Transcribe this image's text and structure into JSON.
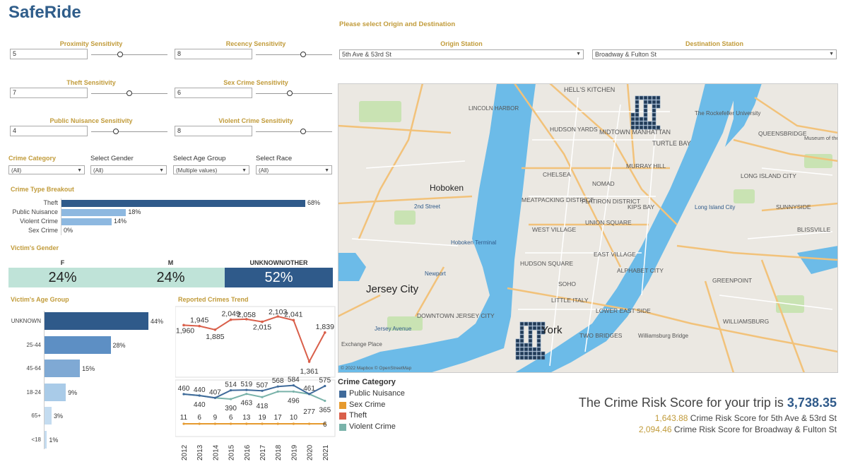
{
  "app_title": "SafeRide",
  "prompt_text": "Please select Origin and Destination",
  "sliders": [
    {
      "label": "Proximity Sensitivity",
      "value": "5",
      "knob": 0.38
    },
    {
      "label": "Recency Sensitivity",
      "value": "8",
      "knob": 0.62
    },
    {
      "label": "Theft Sensitivity",
      "value": "7",
      "knob": 0.5
    },
    {
      "label": "Sex Crime Sensitivity",
      "value": "6",
      "knob": 0.44
    },
    {
      "label": "Public Nuisance Sensitivity",
      "value": "4",
      "knob": 0.32
    },
    {
      "label": "Violent Crime Sensitivity",
      "value": "8",
      "knob": 0.62
    }
  ],
  "origin": {
    "label": "Origin Station",
    "value": "5th Ave & 53rd St"
  },
  "destination": {
    "label": "Destination Station",
    "value": "Broadway & Fulton St"
  },
  "filters": [
    {
      "label": "Crime Category",
      "value": "(All)"
    },
    {
      "label": "Select Gender",
      "value": "(All)"
    },
    {
      "label": "Select Age Group",
      "value": "(Multiple values)"
    },
    {
      "label": "Select Race",
      "value": "(All)"
    }
  ],
  "crime_type": {
    "title": "Crime Type Breakout",
    "items": [
      {
        "label": "Theft",
        "value": 68,
        "text": "68%",
        "color": "#2f5a8a"
      },
      {
        "label": "Public Nuisance",
        "value": 18,
        "text": "18%",
        "color": "#8db8e0"
      },
      {
        "label": "Violent Crime",
        "value": 14,
        "text": "14%",
        "color": "#8db8e0"
      },
      {
        "label": "Sex Crime",
        "value": 0,
        "text": "0%",
        "color": "#8db8e0"
      }
    ]
  },
  "gender": {
    "title": "Victim's Gender",
    "items": [
      {
        "label": "F",
        "value": "24%",
        "bg": "#bfe3d8",
        "fg": "#222"
      },
      {
        "label": "M",
        "value": "24%",
        "bg": "#bfe3d8",
        "fg": "#222"
      },
      {
        "label": "UNKNOWN/OTHER",
        "value": "52%",
        "bg": "#2f5a8a",
        "fg": "#fff"
      }
    ]
  },
  "age": {
    "title": "Victim's Age Group",
    "items": [
      {
        "label": "UNKNOWN",
        "value": 44,
        "text": "44%",
        "color": "#2f5a8a"
      },
      {
        "label": "25-44",
        "value": 28,
        "text": "28%",
        "color": "#5d8fc4"
      },
      {
        "label": "45-64",
        "value": 15,
        "text": "15%",
        "color": "#7fa9d4"
      },
      {
        "label": "18-24",
        "value": 9,
        "text": "9%",
        "color": "#a9cbe8"
      },
      {
        "label": "65+",
        "value": 3,
        "text": "3%",
        "color": "#c4dcf0"
      },
      {
        "label": "<18",
        "value": 1,
        "text": "1%",
        "color": "#c4dcf0"
      }
    ]
  },
  "chart_data": {
    "type": "line",
    "title": "Reported Crimes Trend",
    "x": [
      "2012",
      "2013",
      "2014",
      "2015",
      "2016",
      "2017",
      "2018",
      "2019",
      "2020",
      "2021"
    ],
    "totals": [
      1960,
      1945,
      1885,
      2049,
      2058,
      2015,
      2103,
      2041,
      1361,
      1839
    ],
    "totals_labels": [
      "1,960",
      "1,945",
      "1,885",
      "2,049",
      "2,058",
      "2,015",
      "2,103",
      "2,041",
      "1,361",
      "1,839"
    ],
    "series": [
      {
        "name": "Public Nuisance",
        "color": "#3f6a9a",
        "values": [
          460,
          440,
          407,
          514,
          519,
          507,
          568,
          584,
          461,
          575
        ]
      },
      {
        "name": "Sex Crime",
        "color": "#e69a2e",
        "values": [
          11,
          6,
          9,
          6,
          13,
          19,
          17,
          10,
          277,
          6
        ]
      },
      {
        "name": "Theft",
        "color": "#d95f4a",
        "values": [
          1960,
          1945,
          1885,
          2049,
          2058,
          2015,
          2103,
          2041,
          1361,
          1839
        ]
      },
      {
        "name": "Violent Crime",
        "color": "#7ab3aa",
        "values": [
          460,
          440,
          407,
          390,
          463,
          418,
          496,
          496,
          461,
          365
        ]
      }
    ],
    "bottom_labels": {
      "pn": [
        "460",
        "440",
        "407",
        "514",
        "519",
        "507",
        "568",
        "584",
        "461",
        "575"
      ],
      "vc": [
        "",
        "440",
        "",
        "390",
        "463",
        "418",
        "",
        "496",
        "",
        "365"
      ],
      "sc": [
        "11",
        "6",
        "9",
        "6",
        "13",
        "19",
        "17",
        "10",
        "277",
        "6"
      ]
    }
  },
  "legend": {
    "title": "Crime Category",
    "items": [
      {
        "name": "Public Nuisance",
        "color": "#3f6a9a"
      },
      {
        "name": "Sex Crime",
        "color": "#e69a2e"
      },
      {
        "name": "Theft",
        "color": "#d95f4a"
      },
      {
        "name": "Violent Crime",
        "color": "#7ab3aa"
      }
    ]
  },
  "score": {
    "prefix": "The Crime Risk Score for your trip is",
    "value": "3,738.35",
    "origin_value": "1,643.88",
    "origin_text": "Crime Risk Score for 5th Ave & 53rd St",
    "dest_value": "2,094.46",
    "dest_text": "Crime Risk Score for Broadway & Fulton St"
  },
  "map": {
    "copyright": "© 2022 Mapbox © OpenStreetMap",
    "labels": [
      "HELL'S KITCHEN",
      "The Rockefeller University",
      "LINCOLN HARBOR",
      "MIDTOWN MANHATTAN",
      "TURTLE BAY",
      "HUDSON YARDS",
      "QUEENSBRIDGE",
      "Museum of the Moving Image",
      "MURRAY HILL",
      "Hoboken",
      "CHELSEA",
      "NOMAD",
      "LONG ISLAND CITY",
      "2nd Street",
      "MEATPACKING DISTRICT",
      "FLATIRON DISTRICT",
      "KIPS BAY",
      "SUNNYSIDE",
      "Long Island City",
      "WEST VILLAGE",
      "UNION SQUARE",
      "Hoboken Terminal",
      "Newport",
      "HUDSON SQUARE",
      "EAST VILLAGE",
      "ALPHABET CITY",
      "GREENPOINT",
      "Jersey City",
      "SOHO",
      "DOWNTOWN JERSEY CITY",
      "LITTLE ITALY",
      "LOWER EAST SIDE",
      "WILLIAMSBURG",
      "Jersey Avenue",
      "York",
      "TWO BRIDGES",
      "Williamsburg Bridge",
      "BLISSVILLE",
      "Exchange Place"
    ]
  }
}
